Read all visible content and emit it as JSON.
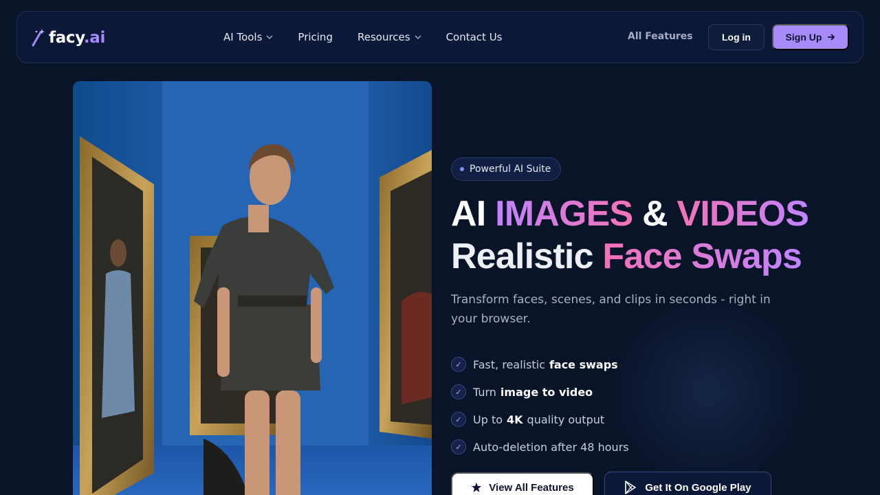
{
  "brand": {
    "name_main": "facy",
    "name_dot": ".ai",
    "accent": "#a78bfa"
  },
  "nav": {
    "links": [
      {
        "label": "AI Tools",
        "dropdown": true
      },
      {
        "label": "Pricing",
        "dropdown": false
      },
      {
        "label": "Resources",
        "dropdown": true
      },
      {
        "label": "Contact Us",
        "dropdown": false
      }
    ],
    "all_features": "All Features",
    "login": "Log in",
    "signup": "Sign Up"
  },
  "hero": {
    "badge": "Powerful AI Suite",
    "headline": {
      "l1_a": "AI",
      "l1_b": "IMAGES",
      "l1_c": "&",
      "l1_d": "VIDEOS",
      "l2_a": "Realistic",
      "l2_b": "Face Swaps"
    },
    "subtitle": "Transform faces, scenes, and clips in seconds - right in your browser.",
    "features": [
      {
        "pre": "Fast, realistic",
        "bold": "face swaps",
        "post": ""
      },
      {
        "pre": "Turn",
        "bold": "image to video",
        "post": ""
      },
      {
        "pre": "Up to",
        "bold": "4K",
        "post": "quality output"
      },
      {
        "pre": "Auto-deletion after 48 hours",
        "bold": "",
        "post": ""
      }
    ],
    "cta_primary": "View All Features",
    "cta_secondary": "Get It On Google Play"
  },
  "icons": {
    "logo": "magic-wand-icon",
    "dropdown": "chevron-down-icon",
    "signup": "arrow-right-icon",
    "check": "check-icon",
    "primary": "star-icon",
    "secondary": "google-play-icon"
  }
}
